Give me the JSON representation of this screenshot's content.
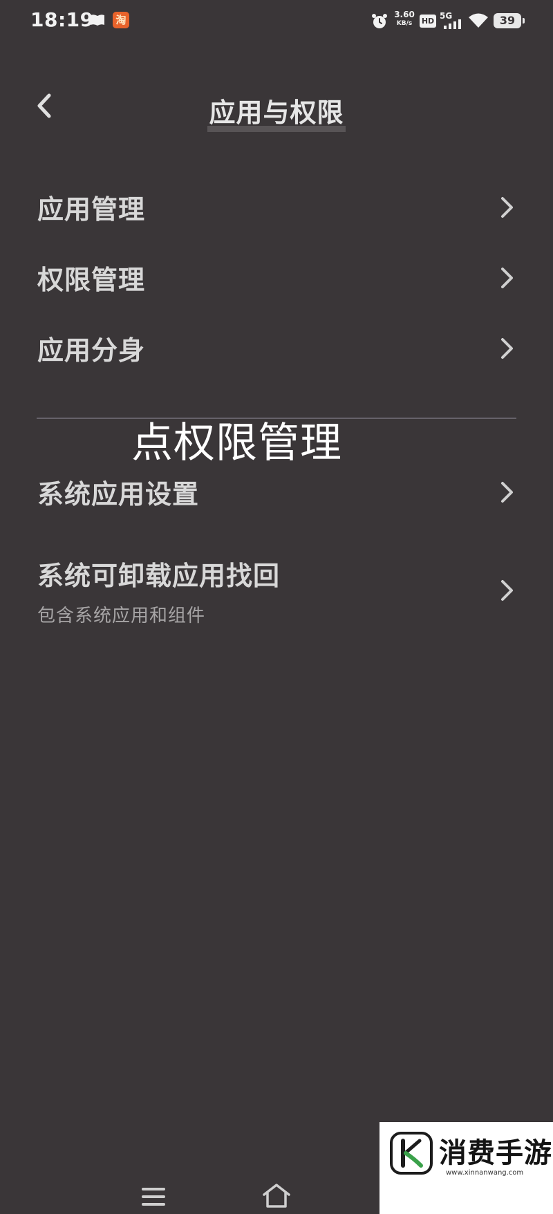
{
  "status_bar": {
    "time": "18:19",
    "app_icon_text": "淘",
    "network_speed_value": "3.60",
    "network_speed_unit": "KB/s",
    "hd_label": "HD",
    "network_type": "5G",
    "battery_level": "39",
    "icons": [
      "book-icon",
      "taobao-app-icon",
      "alarm-icon",
      "signal-icon",
      "wifi-icon",
      "battery-icon"
    ]
  },
  "header": {
    "title": "应用与权限",
    "back_icon": "chevron-left-icon"
  },
  "menu": {
    "items": [
      {
        "label": "应用管理",
        "icon": "chevron-right-icon"
      },
      {
        "label": "权限管理",
        "icon": "chevron-right-icon"
      },
      {
        "label": "应用分身",
        "icon": "chevron-right-icon"
      },
      {
        "label": "系统应用设置",
        "icon": "chevron-right-icon"
      },
      {
        "label": "系统可卸载应用找回",
        "sublabel": "包含系统应用和组件",
        "icon": "chevron-right-icon"
      }
    ]
  },
  "annotation": {
    "text": "点权限管理"
  },
  "nav_bar": {
    "icons": [
      "menu-icon",
      "home-icon"
    ]
  },
  "watermark": {
    "text": "消费手游网",
    "url": "www.xinnanwang.com"
  },
  "colors": {
    "background": "#3a3638",
    "text": "#d8d8d8",
    "subtext": "#a7a5a6",
    "divider": "#66626a",
    "app_icon": "#e8632b"
  }
}
